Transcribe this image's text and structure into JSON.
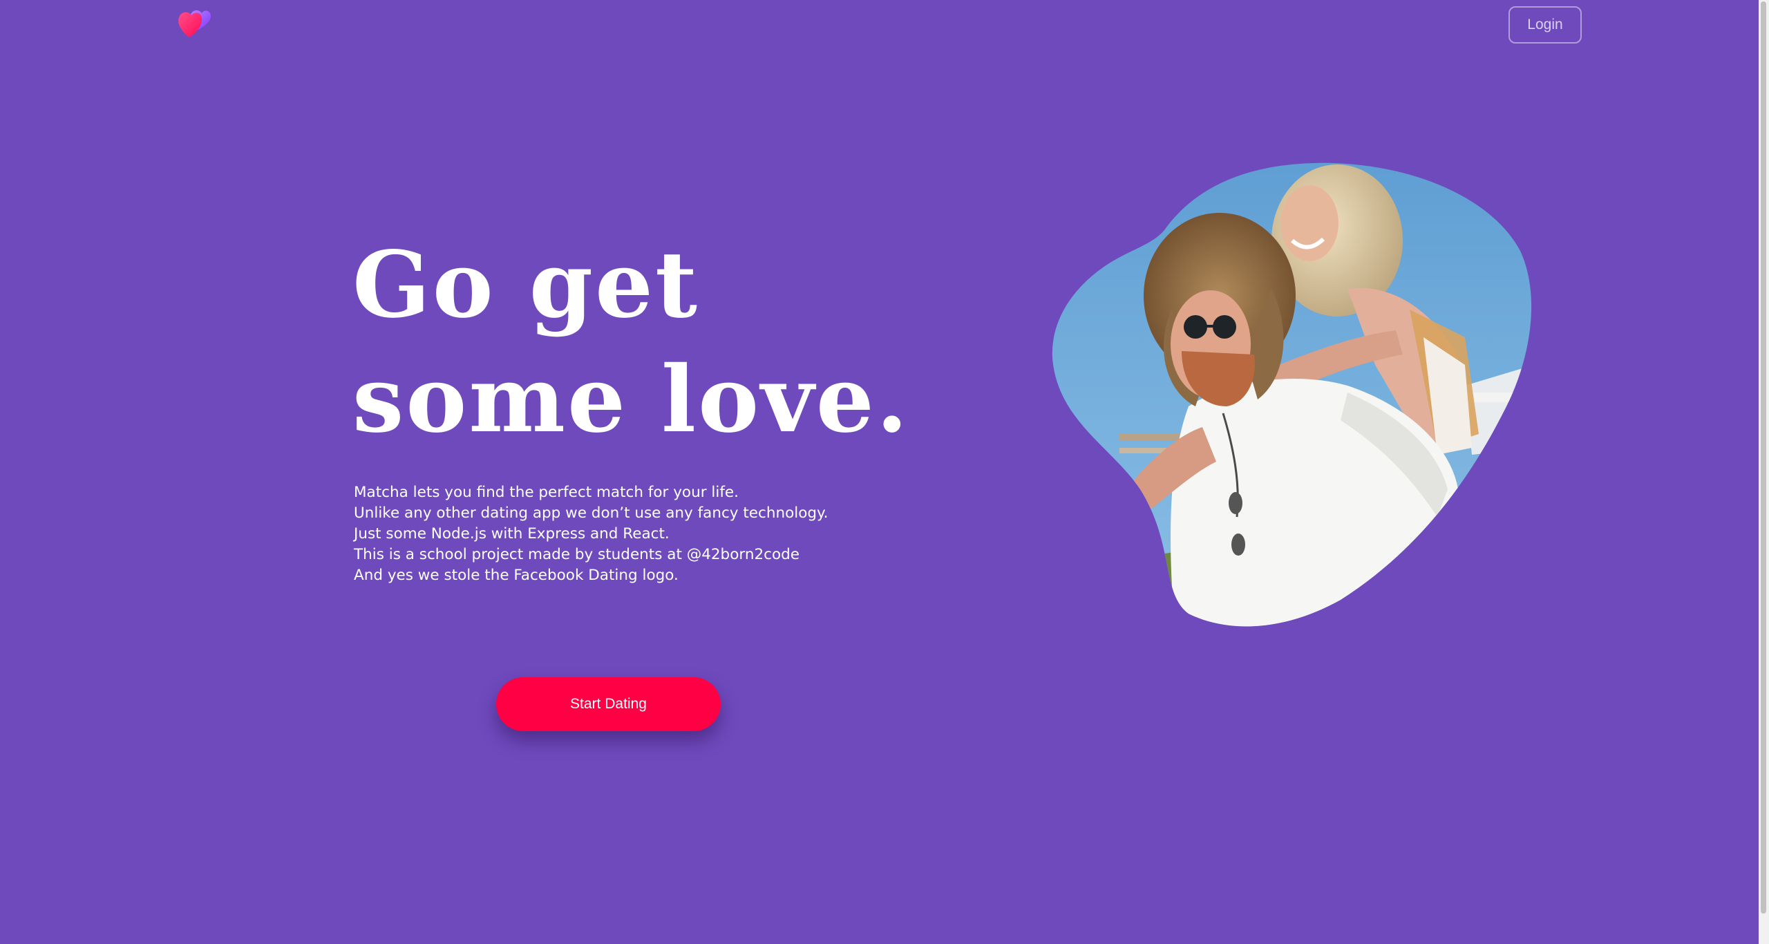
{
  "brand": {
    "logo_icon": "heart-logo-icon",
    "accent_color": "#ff0044",
    "background_color": "#6f4abd"
  },
  "header": {
    "login_label": "Login"
  },
  "hero": {
    "headline_line1": "Go get",
    "headline_line2": "some love.",
    "description_lines": [
      "Matcha lets you find the perfect match for your life.",
      "Unlike any other dating app we don’t use any fancy technology.",
      "Just some Node.js with Express and React.",
      "This is a school project made by students at @42born2code",
      "And yes we stole the Facebook Dating logo."
    ],
    "cta_label": "Start Dating",
    "photo": "couple-photo"
  }
}
